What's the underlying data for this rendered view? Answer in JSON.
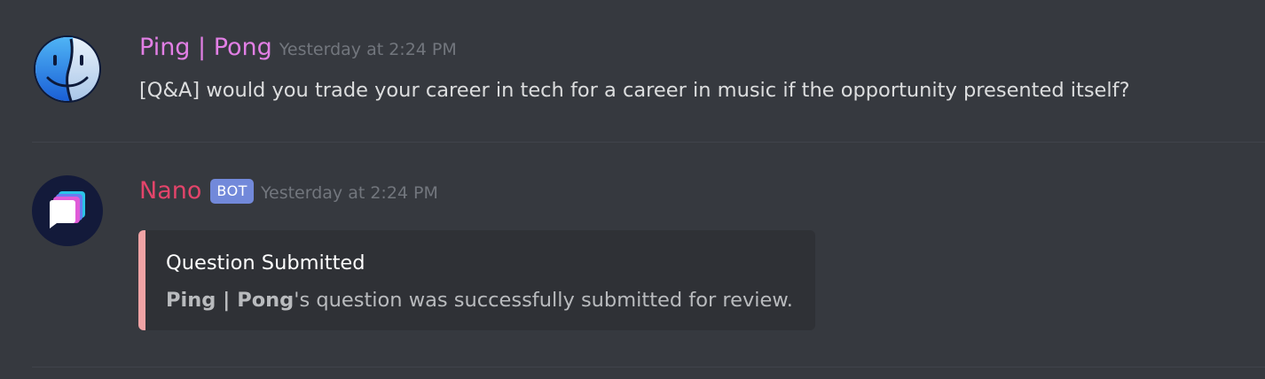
{
  "messages": [
    {
      "username": "Ping | Pong",
      "username_color": "#e27fe5",
      "timestamp": "Yesterday at 2:24 PM",
      "content": "[Q&A] would you trade your career in tech for a career in music if the opportunity presented itself?",
      "avatar_icon": "finder-face-icon"
    },
    {
      "username": "Nano",
      "username_color": "#e3446a",
      "bot_tag": "BOT",
      "timestamp": "Yesterday at 2:24 PM",
      "avatar_icon": "chat-bubble-icon",
      "embed": {
        "border_color": "#f0a3a5",
        "title": "Question Submitted",
        "description_bold": "Ping | Pong",
        "description_rest": "'s question was successfully submitted for review."
      }
    }
  ],
  "colors": {
    "background": "#36393f",
    "text": "#dcddde",
    "timestamp": "#72767d",
    "bot_tag_bg": "#7289da",
    "embed_bg": "#2f3136"
  }
}
